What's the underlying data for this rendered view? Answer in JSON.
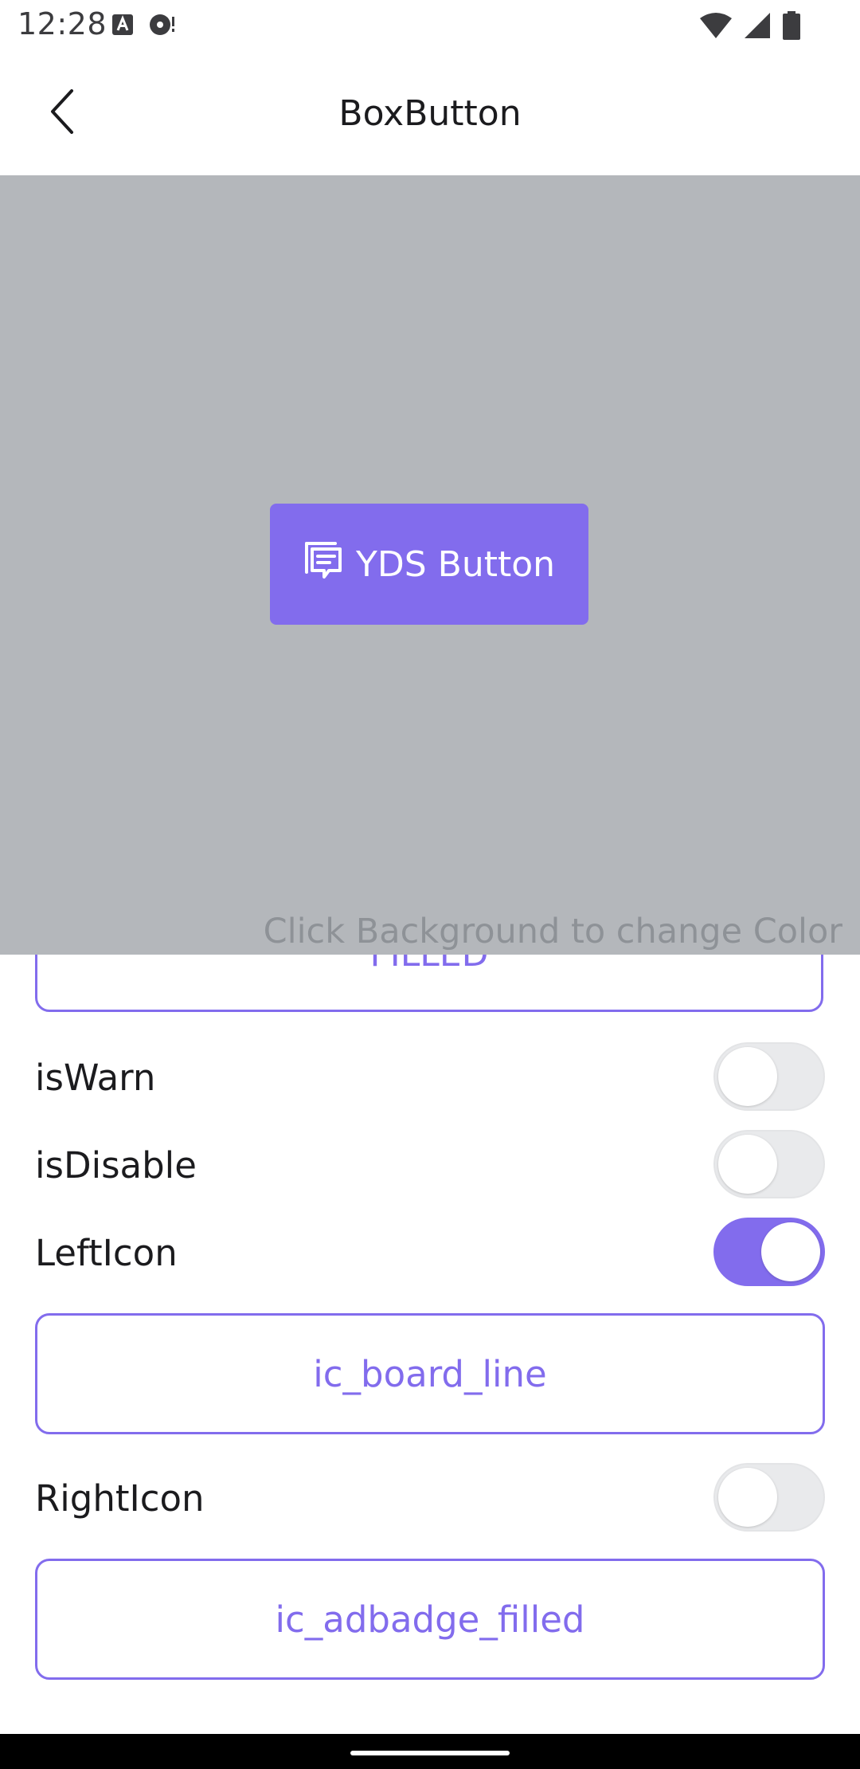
{
  "status_bar": {
    "time": "12:28",
    "left_icons": [
      "text-a-icon",
      "sync-dot-icon"
    ],
    "right_icons": [
      "wifi-icon",
      "cellular-signal-icon",
      "battery-icon"
    ]
  },
  "app_bar": {
    "title": "BoxButton",
    "back_icon": "chevron-left-icon"
  },
  "preview": {
    "background_color": "#b4b7bb",
    "button": {
      "label": "YDS Button",
      "left_icon": "board-line-icon",
      "color": "#826ced"
    },
    "hint": "Click Background to change Color"
  },
  "options": {
    "style_select": {
      "value": "FILLED"
    },
    "is_warn": {
      "label": "isWarn",
      "checked": false
    },
    "is_disable": {
      "label": "isDisable",
      "checked": false
    },
    "left_icon": {
      "label": "LeftIcon",
      "checked": true,
      "selected_icon": "ic_board_line"
    },
    "right_icon": {
      "label": "RightIcon",
      "checked": false,
      "selected_icon": "ic_adbadge_filled"
    }
  },
  "colors": {
    "accent": "#826ced",
    "switch_off": "#e9eaec",
    "preview_bg": "#b4b7bb"
  }
}
